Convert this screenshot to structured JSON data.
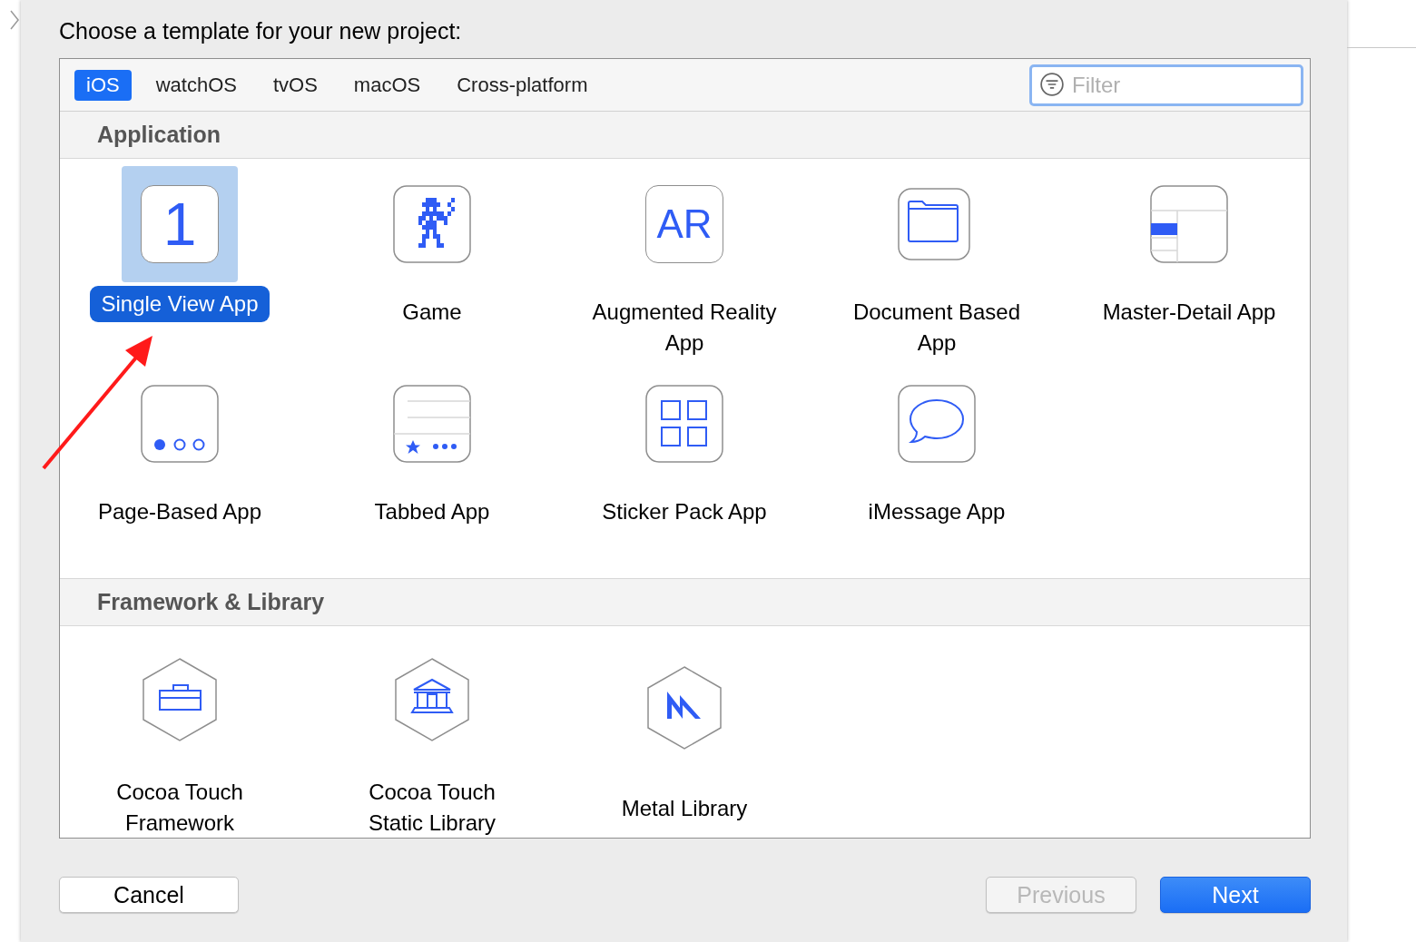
{
  "dialog": {
    "title": "Choose a template for your new project:"
  },
  "tabs": [
    {
      "label": "iOS",
      "selected": true
    },
    {
      "label": "watchOS",
      "selected": false
    },
    {
      "label": "tvOS",
      "selected": false
    },
    {
      "label": "macOS",
      "selected": false
    },
    {
      "label": "Cross-platform",
      "selected": false
    }
  ],
  "filter": {
    "placeholder": "Filter"
  },
  "sections": [
    {
      "title": "Application",
      "templates": [
        {
          "kind": "number",
          "glyph": "1",
          "label": "Single View App",
          "selected": true
        },
        {
          "kind": "game",
          "label": "Game",
          "selected": false
        },
        {
          "kind": "lettered",
          "glyph": "AR",
          "label": "Augmented Reality App",
          "selected": false
        },
        {
          "kind": "folder",
          "label": "Document Based App",
          "selected": false
        },
        {
          "kind": "split",
          "label": "Master-Detail App",
          "selected": false
        },
        {
          "kind": "pages",
          "label": "Page-Based App",
          "selected": false
        },
        {
          "kind": "tabs",
          "label": "Tabbed App",
          "selected": false
        },
        {
          "kind": "grid",
          "label": "Sticker Pack App",
          "selected": false
        },
        {
          "kind": "bubble",
          "label": "iMessage App",
          "selected": false
        }
      ]
    },
    {
      "title": "Framework & Library",
      "templates": [
        {
          "kind": "toolbox",
          "label": "Cocoa Touch Framework",
          "selected": false
        },
        {
          "kind": "building",
          "label": "Cocoa Touch Static Library",
          "selected": false
        },
        {
          "kind": "metal",
          "label": "Metal Library",
          "selected": false
        }
      ]
    }
  ],
  "buttons": [
    {
      "label": "Cancel",
      "kind": "plain",
      "disabled": false
    },
    {
      "label": "Previous",
      "kind": "plain",
      "disabled": true
    },
    {
      "label": "Next",
      "kind": "primary",
      "disabled": false
    }
  ]
}
